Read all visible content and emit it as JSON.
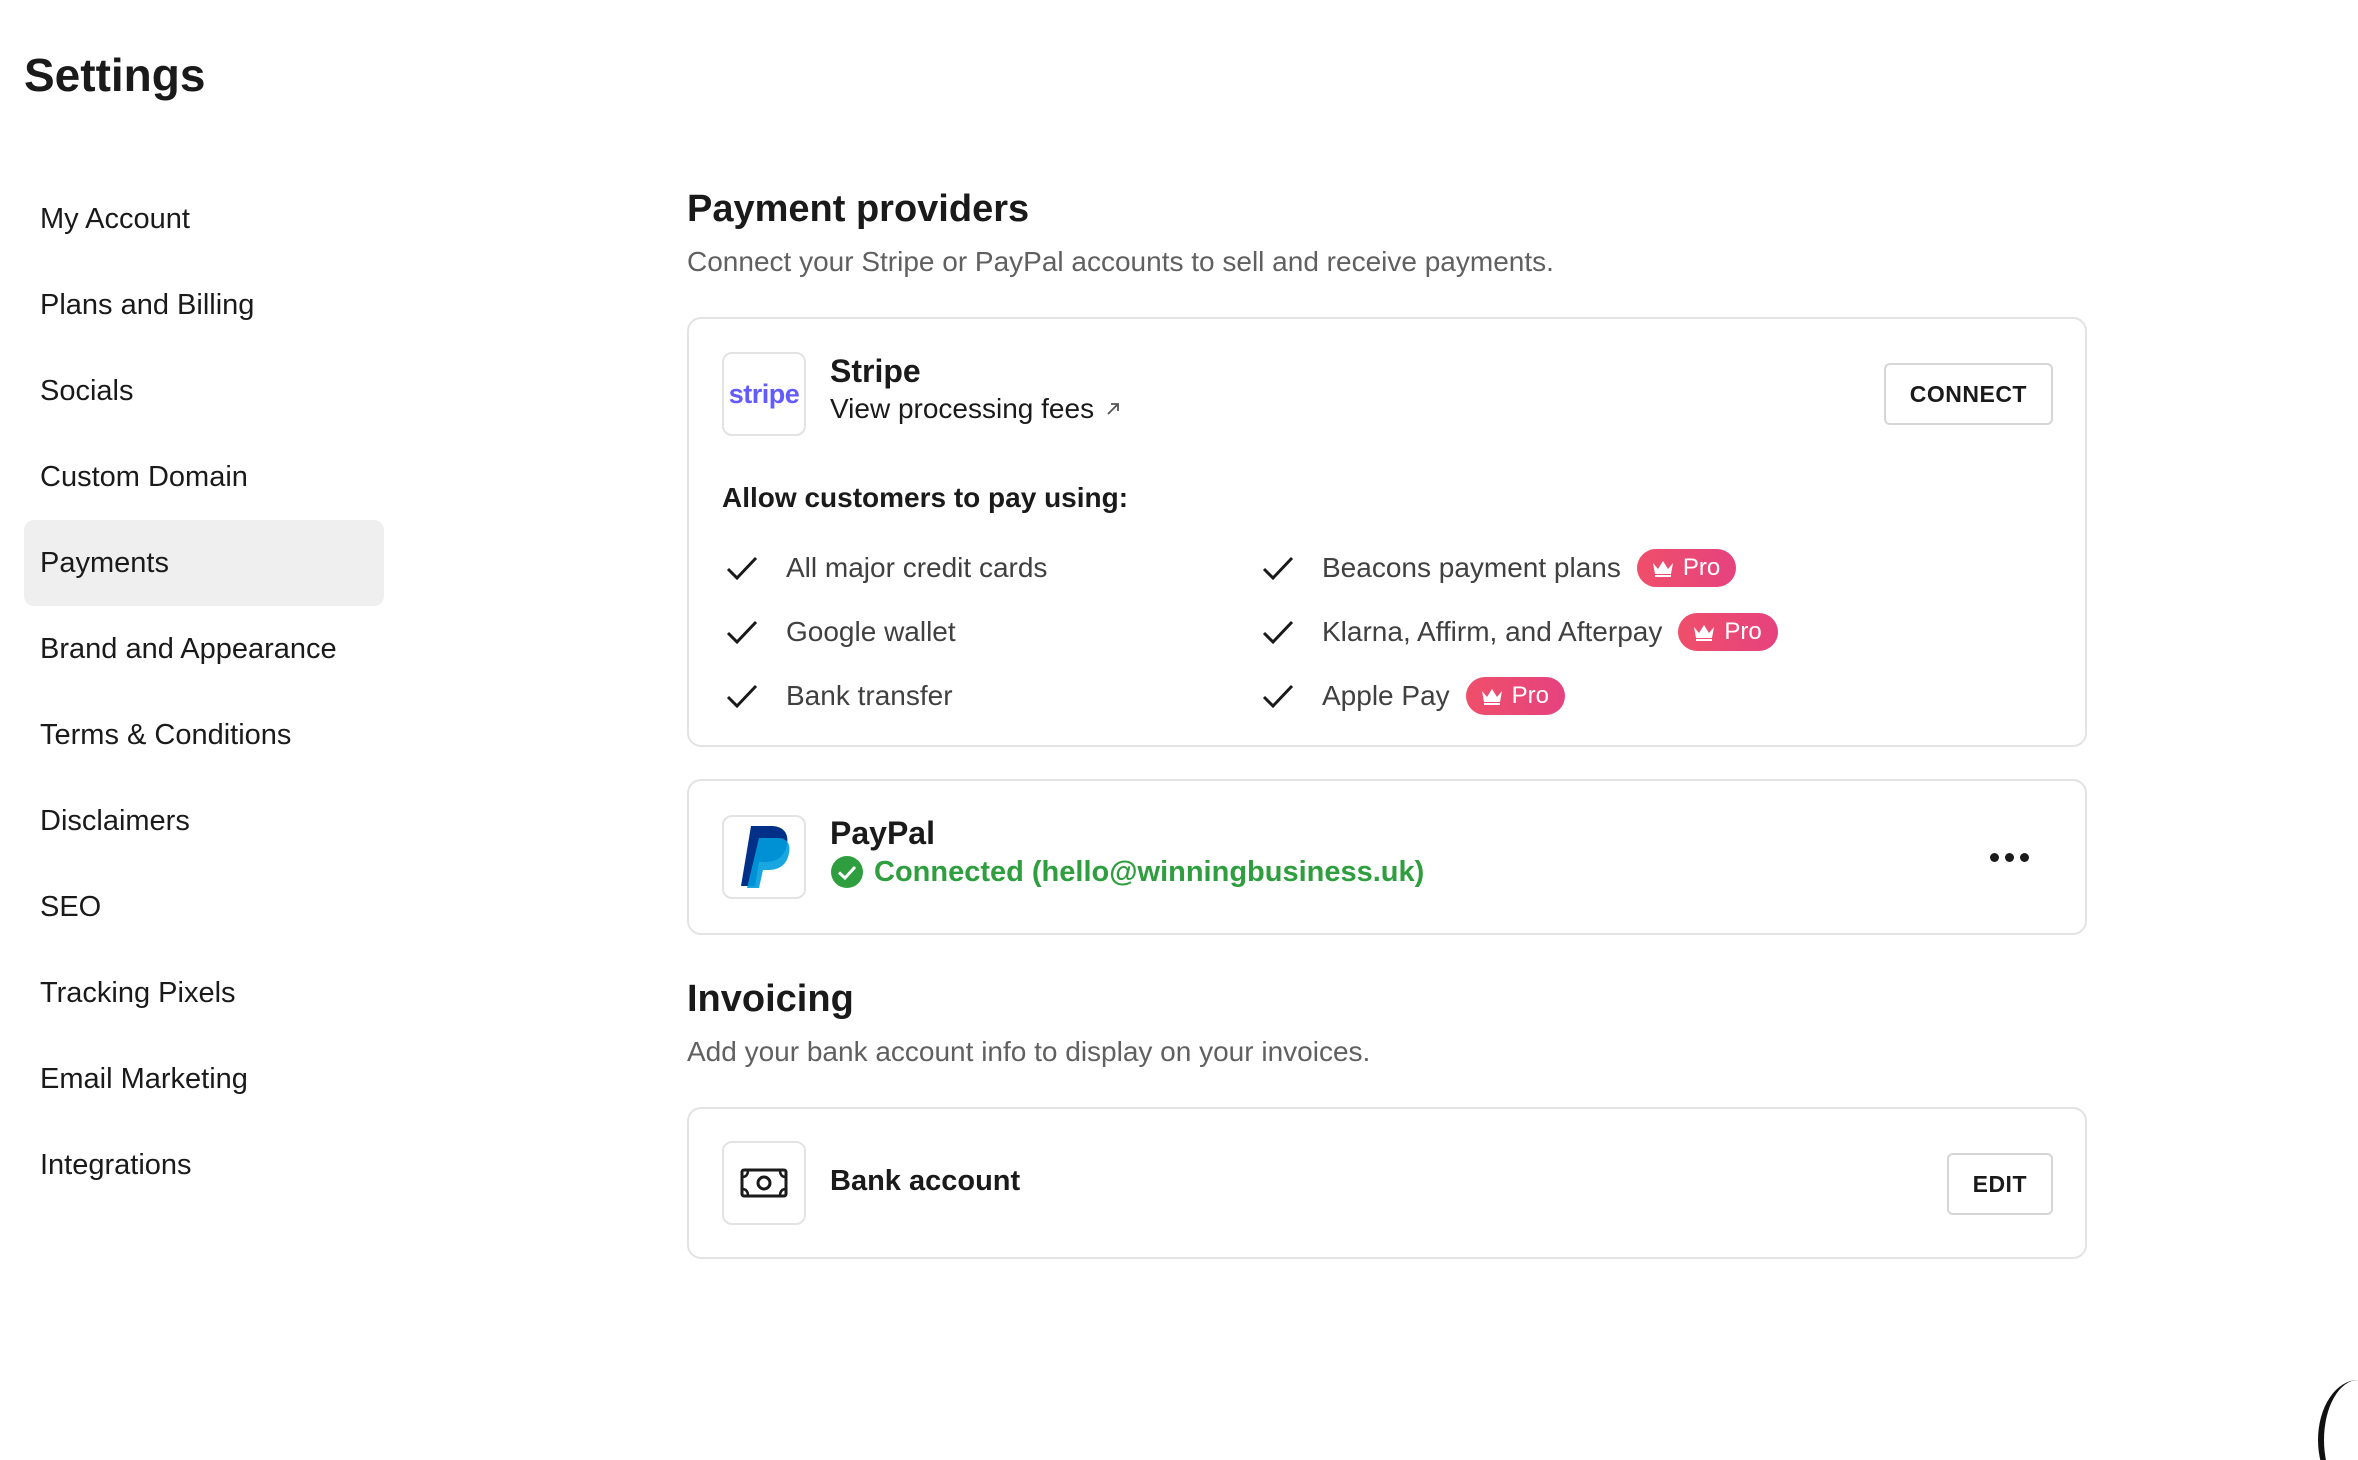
{
  "page": {
    "title": "Settings"
  },
  "sidebar": {
    "items": [
      {
        "label": "My Account"
      },
      {
        "label": "Plans and Billing"
      },
      {
        "label": "Socials"
      },
      {
        "label": "Custom Domain"
      },
      {
        "label": "Payments",
        "active": true
      },
      {
        "label": "Brand and Appearance"
      },
      {
        "label": "Terms & Conditions"
      },
      {
        "label": "Disclaimers"
      },
      {
        "label": "SEO"
      },
      {
        "label": "Tracking Pixels"
      },
      {
        "label": "Email Marketing"
      },
      {
        "label": "Integrations"
      }
    ]
  },
  "payment_providers": {
    "title": "Payment providers",
    "description": "Connect your Stripe or PayPal accounts to sell and receive payments.",
    "stripe": {
      "logo_text": "stripe",
      "name": "Stripe",
      "fees_link": "View processing fees",
      "connect_label": "CONNECT",
      "allow_label": "Allow customers to pay using:",
      "methods_left": [
        {
          "label": "All major credit cards"
        },
        {
          "label": "Google wallet"
        },
        {
          "label": "Bank transfer"
        }
      ],
      "methods_right": [
        {
          "label": "Beacons payment plans",
          "badge": "Pro"
        },
        {
          "label": "Klarna, Affirm, and Afterpay",
          "badge": "Pro"
        },
        {
          "label": "Apple Pay",
          "badge": "Pro"
        }
      ]
    },
    "paypal": {
      "name": "PayPal",
      "status": "Connected (hello@winningbusiness.uk)"
    }
  },
  "invoicing": {
    "title": "Invoicing",
    "description": "Add your bank account info to display on your invoices.",
    "bank": {
      "label": "Bank account",
      "edit_label": "EDIT"
    }
  },
  "colors": {
    "stripe_brand": "#635bff",
    "paypal_dark": "#003087",
    "paypal_light": "#009cde",
    "connected_green": "#2e9e3e",
    "pro_badge": "#e6427f",
    "active_nav_bg": "#efefef"
  }
}
